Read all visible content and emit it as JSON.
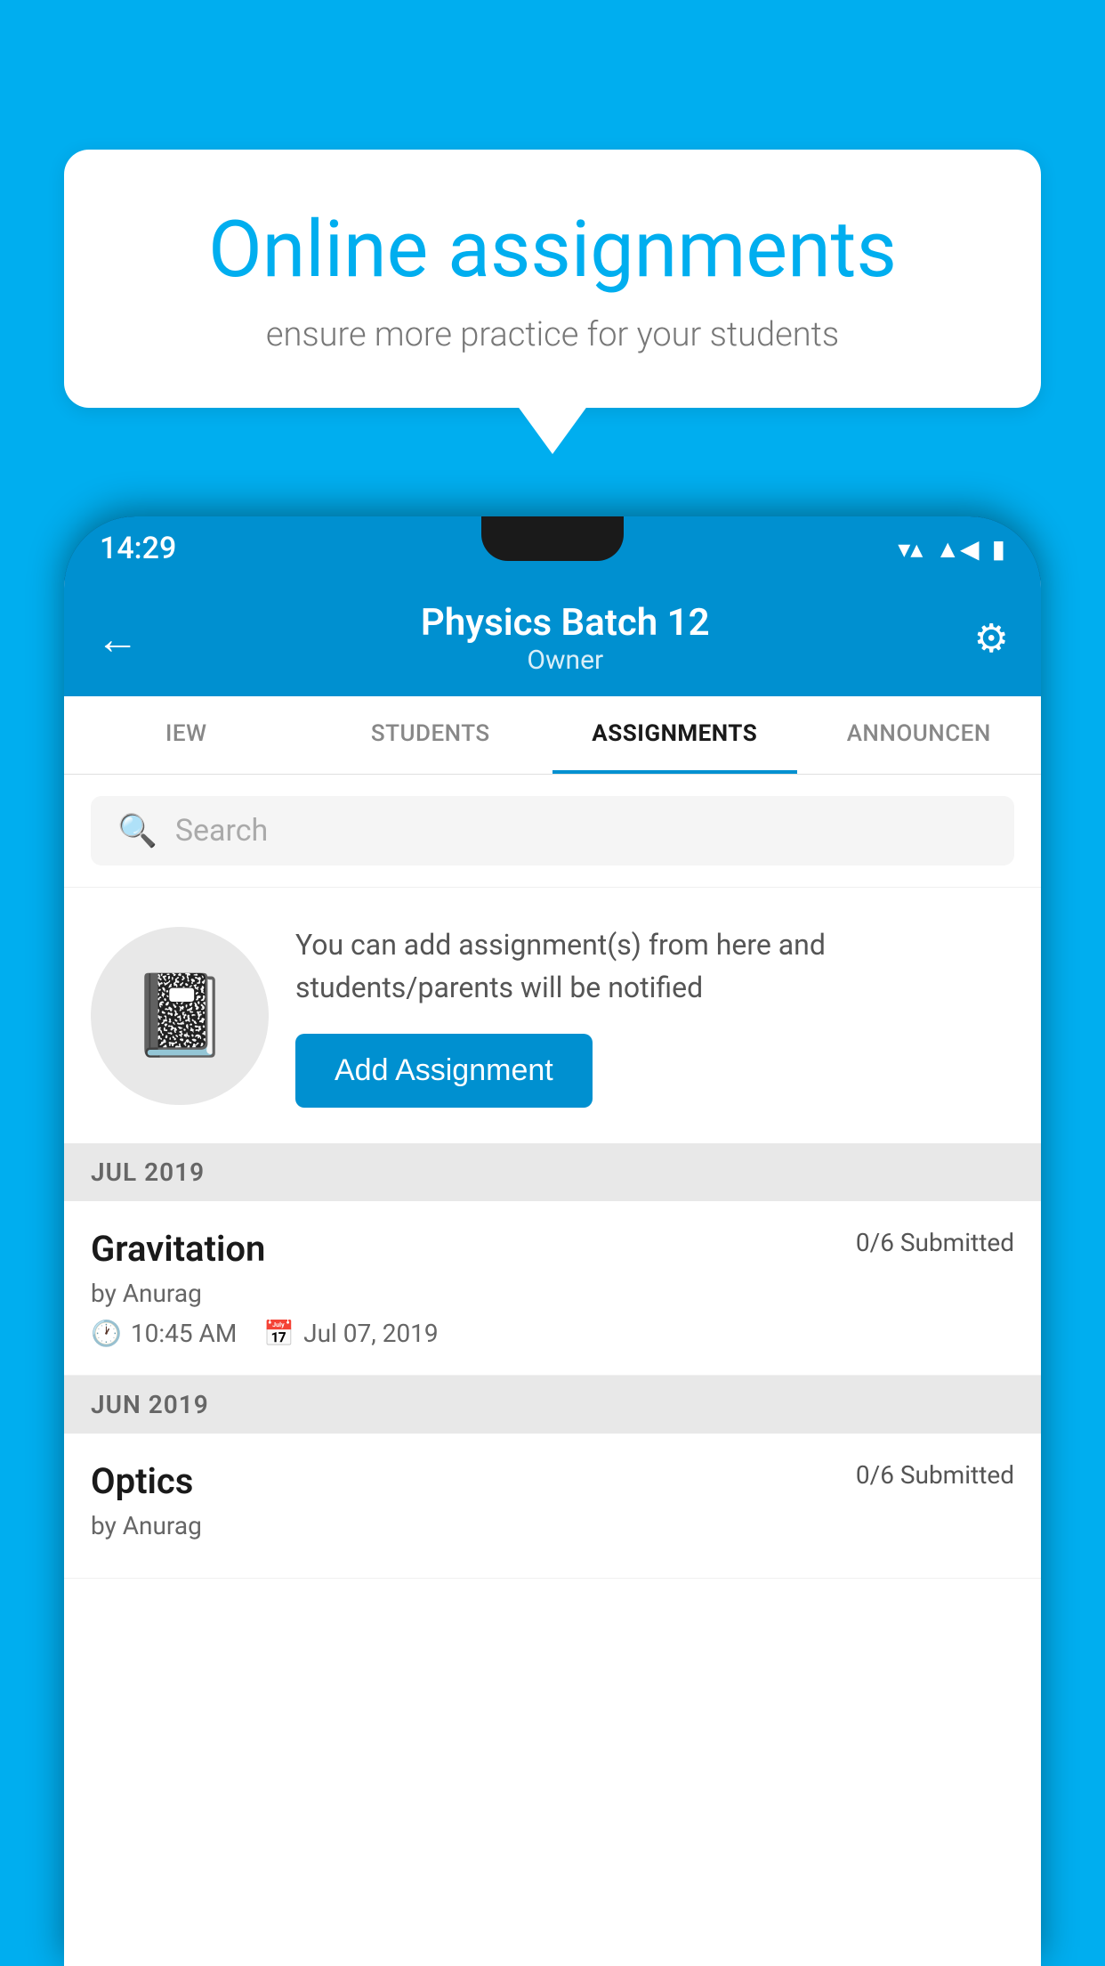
{
  "background_color": "#00AEEF",
  "speech_bubble": {
    "title": "Online assignments",
    "subtitle": "ensure more practice for your students"
  },
  "phone": {
    "status_bar": {
      "time": "14:29",
      "icons": [
        "wifi",
        "signal",
        "battery"
      ]
    },
    "app_bar": {
      "title": "Physics Batch 12",
      "subtitle": "Owner",
      "back_label": "←",
      "settings_icon_label": "⚙"
    },
    "tabs": [
      {
        "label": "IEW",
        "active": false
      },
      {
        "label": "STUDENTS",
        "active": false
      },
      {
        "label": "ASSIGNMENTS",
        "active": true
      },
      {
        "label": "ANNOUNCEN",
        "active": false
      }
    ],
    "search": {
      "placeholder": "Search"
    },
    "promo": {
      "description": "You can add assignment(s) from here and students/parents will be notified",
      "button_label": "Add Assignment"
    },
    "sections": [
      {
        "header": "JUL 2019",
        "assignments": [
          {
            "name": "Gravitation",
            "submitted": "0/6 Submitted",
            "by": "by Anurag",
            "time": "10:45 AM",
            "date": "Jul 07, 2019"
          }
        ]
      },
      {
        "header": "JUN 2019",
        "assignments": [
          {
            "name": "Optics",
            "submitted": "0/6 Submitted",
            "by": "by Anurag",
            "time": "",
            "date": ""
          }
        ]
      }
    ]
  }
}
